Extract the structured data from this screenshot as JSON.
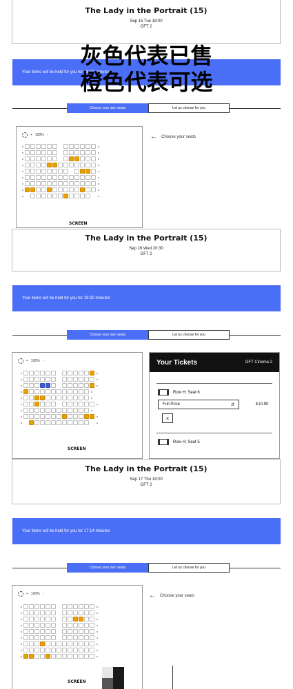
{
  "overlay": {
    "line1": "灰色代表已售",
    "line2": "橙色代表可选"
  },
  "films": [
    {
      "title": "The Lady in the Portrait (15)",
      "date": "Sep 15  Tue 18:00",
      "screen": "GFT 2"
    },
    {
      "title": "The Lady in the Portrait (15)",
      "date": "Sep 16  Wed 20:30",
      "screen": "GFT 2"
    },
    {
      "title": "The Lady in the Portrait (15)",
      "date": "Sep 17  Thu 18:00",
      "screen": "GFT 2"
    }
  ],
  "hold_bars": [
    "Your items will be held for you for 18:32 minutes",
    "Your items will be held for you for 19:30 minutes",
    "Your items will be held for you for 17:14 minutes"
  ],
  "toggle": {
    "own": "Choose your own seats",
    "auto": "Let us choose for you"
  },
  "seatmap": {
    "zoom": "100%",
    "plus": "+",
    "minus": "-",
    "screen_label": "SCREEN"
  },
  "choose_link": "Choose your seats",
  "panel": {
    "title": "Your Tickets",
    "cinema": "GFT Cinema 2",
    "tickets": [
      {
        "label": "Row H; Seat 6",
        "price_type": "Full Price",
        "price": "£10.90",
        "remove": "×"
      },
      {
        "label": "Row H; Seat 5"
      }
    ]
  },
  "colors": {
    "accent_blue": "#4a6ef5",
    "selected_orange": "#e8a100",
    "blue_seat": "#4060d8"
  },
  "icons": {
    "back": "left-arrow-icon",
    "remove": "close-icon",
    "ticket": "ticket-icon",
    "select": "updown-icon",
    "zoom": "crosshair-icon"
  }
}
